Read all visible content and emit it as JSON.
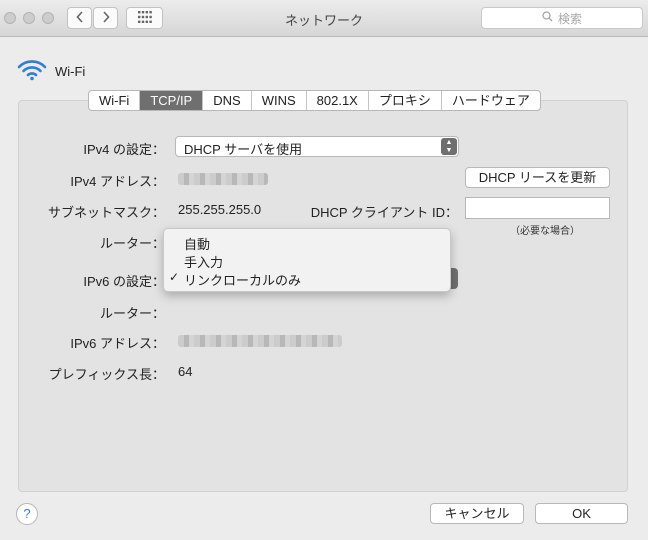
{
  "window": {
    "title": "ネットワーク"
  },
  "search": {
    "placeholder": "検索"
  },
  "header": {
    "interface_name": "Wi-Fi"
  },
  "tabs": [
    {
      "label": "Wi-Fi",
      "active": false
    },
    {
      "label": "TCP/IP",
      "active": true
    },
    {
      "label": "DNS",
      "active": false
    },
    {
      "label": "WINS",
      "active": false
    },
    {
      "label": "802.1X",
      "active": false
    },
    {
      "label": "プロキシ",
      "active": false
    },
    {
      "label": "ハードウェア",
      "active": false
    }
  ],
  "form": {
    "ipv4_config_label": "IPv4 の設定：",
    "ipv4_config_value": "DHCP サーバを使用",
    "ipv4_address_label": "IPv4 アドレス：",
    "renew_dhcp_button": "DHCP リースを更新",
    "subnet_label": "サブネットマスク：",
    "subnet_value": "255.255.255.0",
    "dhcp_client_id_label": "DHCP クライアント ID：",
    "dhcp_client_id_value": "",
    "dhcp_client_id_hint": "（必要な場合）",
    "router_label": "ルーター：",
    "ipv6_config_label": "IPv6 の設定：",
    "router6_label": "ルーター：",
    "ipv6_address_label": "IPv6 アドレス：",
    "prefix_label": "プレフィックス長：",
    "prefix_value": "64"
  },
  "ipv6_menu": {
    "options": [
      "自動",
      "手入力",
      "リンクローカルのみ"
    ],
    "selected": "リンクローカルのみ",
    "check_mark": "✓"
  },
  "footer": {
    "help_label": "?",
    "cancel_button": "キャンセル",
    "ok_button": "OK"
  }
}
